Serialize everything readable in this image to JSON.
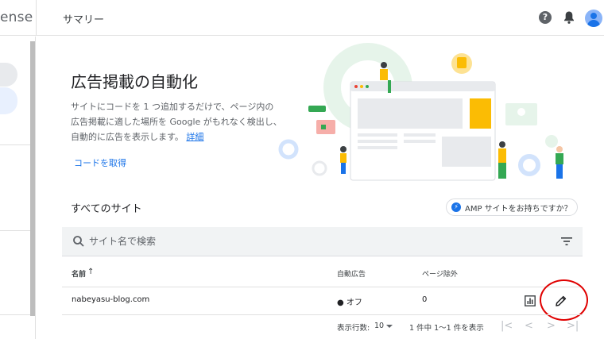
{
  "app": {
    "brand_fragment": "ense"
  },
  "header": {
    "title": "サマリー",
    "help_label": "?"
  },
  "hero": {
    "title": "広告掲載の自動化",
    "description": "サイトにコードを 1 つ追加するだけで、ページ内の広告掲載に適した場所を Google がもれなく検出し、自動的に広告を表示します。",
    "details_link": "詳細",
    "get_code_link": "コードを取得"
  },
  "sites": {
    "heading": "すべてのサイト",
    "amp_button": "AMP サイトをお持ちですか？",
    "search": {
      "placeholder": "サイト名で検索"
    },
    "columns": {
      "name": "名前",
      "auto_ads": "自動広告",
      "page_exclusions": "ページ除外"
    },
    "rows": [
      {
        "site": "nabeyasu-blog.com",
        "auto_ads": "● オフ",
        "page_exclusions": "0"
      }
    ],
    "footer": {
      "rows_per_page_label": "表示行数:",
      "rows_per_page_value": "10",
      "range": "1 件中 1〜1 件を表示"
    }
  },
  "colors": {
    "accent": "#1a73e8",
    "highlight": "#e00000"
  },
  "icons": [
    "help-icon",
    "bell-icon",
    "avatar",
    "search-icon",
    "filter-icon",
    "sort-arrow-icon",
    "report-icon",
    "edit-pencil-icon",
    "amp-icon"
  ]
}
